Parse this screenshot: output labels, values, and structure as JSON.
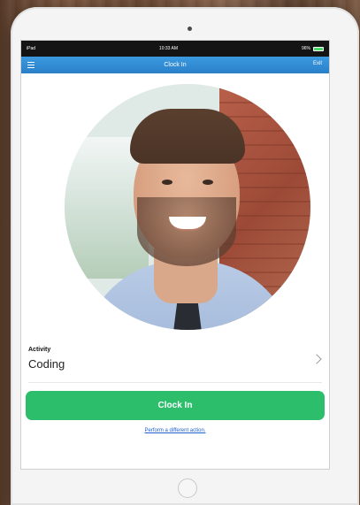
{
  "status_bar": {
    "carrier": "iPad",
    "time": "10:33 AM",
    "battery": "96%",
    "battery_level": 0.96
  },
  "nav": {
    "title": "Clock In",
    "menu_icon": "hamburger-menu-icon",
    "exit_label": "Exit"
  },
  "profile": {
    "photo": "employee-profile-photo"
  },
  "activity": {
    "label": "Activity",
    "value": "Coding",
    "chevron_icon": "chevron-right-icon"
  },
  "actions": {
    "clock_in_label": "Clock In",
    "different_action_label": "Perform a different action."
  },
  "colors": {
    "nav_blue": "#2a7fc8",
    "clock_in_green": "#2dbe6c",
    "link_blue": "#1f5fd1"
  }
}
